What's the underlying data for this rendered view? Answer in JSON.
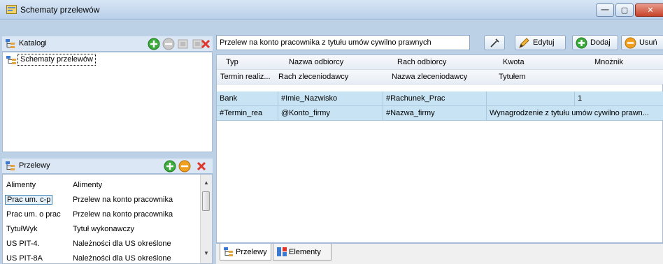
{
  "window": {
    "title": "Schematy przelewów",
    "min_glyph": "—",
    "max_glyph": "▢",
    "close_glyph": "✕"
  },
  "katalogi": {
    "header": "Katalogi",
    "tree_root": "Schematy przelewów"
  },
  "przelewy_panel": {
    "header": "Przelewy",
    "items": [
      {
        "code": "Alimenty",
        "name": "Alimenty"
      },
      {
        "code": "Prac um. c-p",
        "name": "Przelew na konto pracownika"
      },
      {
        "code": "Prac um. o prac",
        "name": "Przelew na konto pracownika"
      },
      {
        "code": "TytułWyk",
        "name": "Tytuł wykonawczy"
      },
      {
        "code": "US PIT-4.",
        "name": "Należności dla US określone"
      },
      {
        "code": "US PIT-8A",
        "name": "Należności dla US określone"
      }
    ],
    "selected_index": 1
  },
  "toolbar": {
    "description_value": "Przelew na konto pracownika z tytułu umów cywilno prawnych",
    "edit_label": "Edytuj",
    "add_label": "Dodaj",
    "delete_label": "Usuń"
  },
  "grid": {
    "header_row1": [
      "Typ",
      "Nazwa odbiorcy",
      "Rach odbiorcy",
      "Kwota",
      "Mnożnik"
    ],
    "header_row2": [
      "Termin realiz...",
      "Rach zleceniodawcy",
      "Nazwa zleceniodawcy",
      "Tytułem"
    ],
    "rows": [
      {
        "typ": "Bank",
        "nazwa_odbiorcy": "#Imie_Nazwisko",
        "rach_odbiorcy": "#Rachunek_Prac",
        "kwota": "",
        "mnoznik": "1"
      },
      {
        "termin": "#Termin_rea",
        "rach_zlec": "@Konto_firmy",
        "nazwa_zlec": "#Nazwa_firmy",
        "tytulem": "Wynagrodzenie z tytułu umów cywilno prawn..."
      }
    ]
  },
  "tabs": [
    {
      "label": "Przelewy",
      "active": true
    },
    {
      "label": "Elementy",
      "active": false
    }
  ],
  "colors": {
    "title_bg": "#c7daef",
    "selection_row": "#c8e4f4",
    "add_green": "#3caa3c",
    "delete_orange": "#f0a020",
    "close_red": "#e0352b"
  }
}
